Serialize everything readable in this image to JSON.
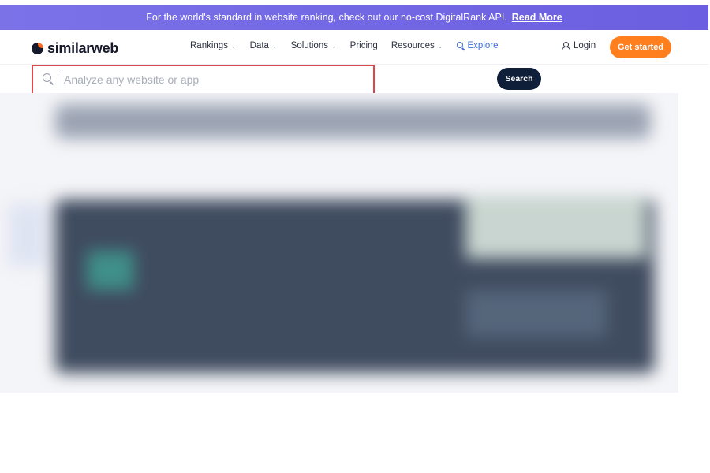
{
  "banner": {
    "text": "For the world's standard in website ranking, check out our no-cost DigitalRank API.",
    "link_label": "Read More"
  },
  "brand": {
    "logo_text": "similarweb",
    "logo_icon": "similarweb-logo-icon"
  },
  "nav": {
    "items": [
      {
        "label": "Rankings",
        "has_dropdown": true
      },
      {
        "label": "Data",
        "has_dropdown": true
      },
      {
        "label": "Solutions",
        "has_dropdown": true
      },
      {
        "label": "Pricing",
        "has_dropdown": false
      },
      {
        "label": "Resources",
        "has_dropdown": true
      },
      {
        "label": "Explore",
        "has_dropdown": false,
        "icon": "search-icon"
      }
    ],
    "login_label": "Login",
    "cta_label": "Get started"
  },
  "search": {
    "placeholder": "Analyze any website or app",
    "value": "",
    "button_label": "Search"
  },
  "colors": {
    "banner": "#6b5ee0",
    "cta": "#ff7f1f",
    "search_button": "#0f1f3a",
    "highlight_border": "#e0474c",
    "explore": "#3f6ddb"
  }
}
